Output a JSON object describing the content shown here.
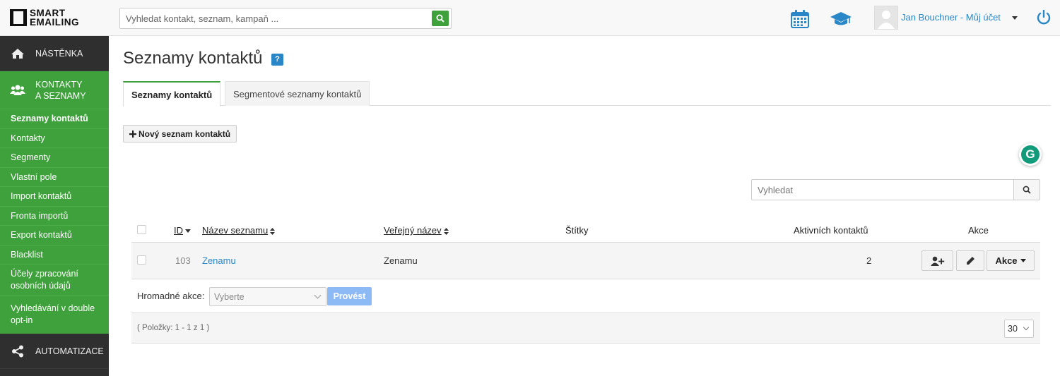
{
  "app": {
    "logo_line1": "SMART",
    "logo_line2": "EMAILING",
    "search_placeholder": "Vyhledat kontakt, seznam, kampaň ...",
    "user_label": "Jan Bouchner - Můj účet"
  },
  "colors": {
    "brand_green": "#3ea13b",
    "sidebar_dark": "#2f2f2f",
    "link_blue": "#2a87c7",
    "disabled_button_blue": "#8dbaf5"
  },
  "sidebar": {
    "dashboard": "NÁSTĚNKA",
    "contacts_line1": "KONTAKTY",
    "contacts_line2": "A SEZNAMY",
    "items": [
      {
        "label": "Seznamy kontaktů",
        "current": true
      },
      {
        "label": "Kontakty"
      },
      {
        "label": "Segmenty"
      },
      {
        "label": "Vlastní pole"
      },
      {
        "label": "Import kontaktů"
      },
      {
        "label": "Fronta importů"
      },
      {
        "label": "Export kontaktů"
      },
      {
        "label": "Blacklist"
      },
      {
        "label": "Účely zpracování osobních údajů"
      },
      {
        "label": "Vyhledávání v double opt-in"
      }
    ],
    "automation": "AUTOMATIZACE"
  },
  "main": {
    "title": "Seznamy kontaktů",
    "help": "?",
    "tabs": [
      {
        "label": "Seznamy kontaktů",
        "active": true
      },
      {
        "label": "Segmentové seznamy kontaktů",
        "active": false
      }
    ],
    "new_button": "Nový seznam kontaktů",
    "grammarly": "G",
    "filter_placeholder": "Vyhledat"
  },
  "table": {
    "headers": {
      "id": "ID",
      "name": "Název seznamu",
      "public_name": "Veřejný název",
      "tags": "Štítky",
      "active_contacts": "Aktivních kontaktů",
      "actions": "Akce"
    },
    "rows": [
      {
        "id": "103",
        "name": "Zenamu",
        "public_name": "Zenamu",
        "tags": "",
        "active_contacts": "2",
        "actions_label": "Akce"
      }
    ],
    "bulk_label": "Hromadné akce:",
    "bulk_select_value": "Vyberte",
    "bulk_button": "Provést",
    "pager": "( Položky: 1 - 1 z 1 )",
    "per_page": "30"
  },
  "icons": [
    "search-icon",
    "calendar-icon",
    "graduation-cap-icon",
    "power-icon",
    "home-icon",
    "users-icon",
    "share-icon",
    "plus-icon",
    "add-user-icon",
    "pencil-icon",
    "caret-down-icon",
    "sort-icon"
  ]
}
